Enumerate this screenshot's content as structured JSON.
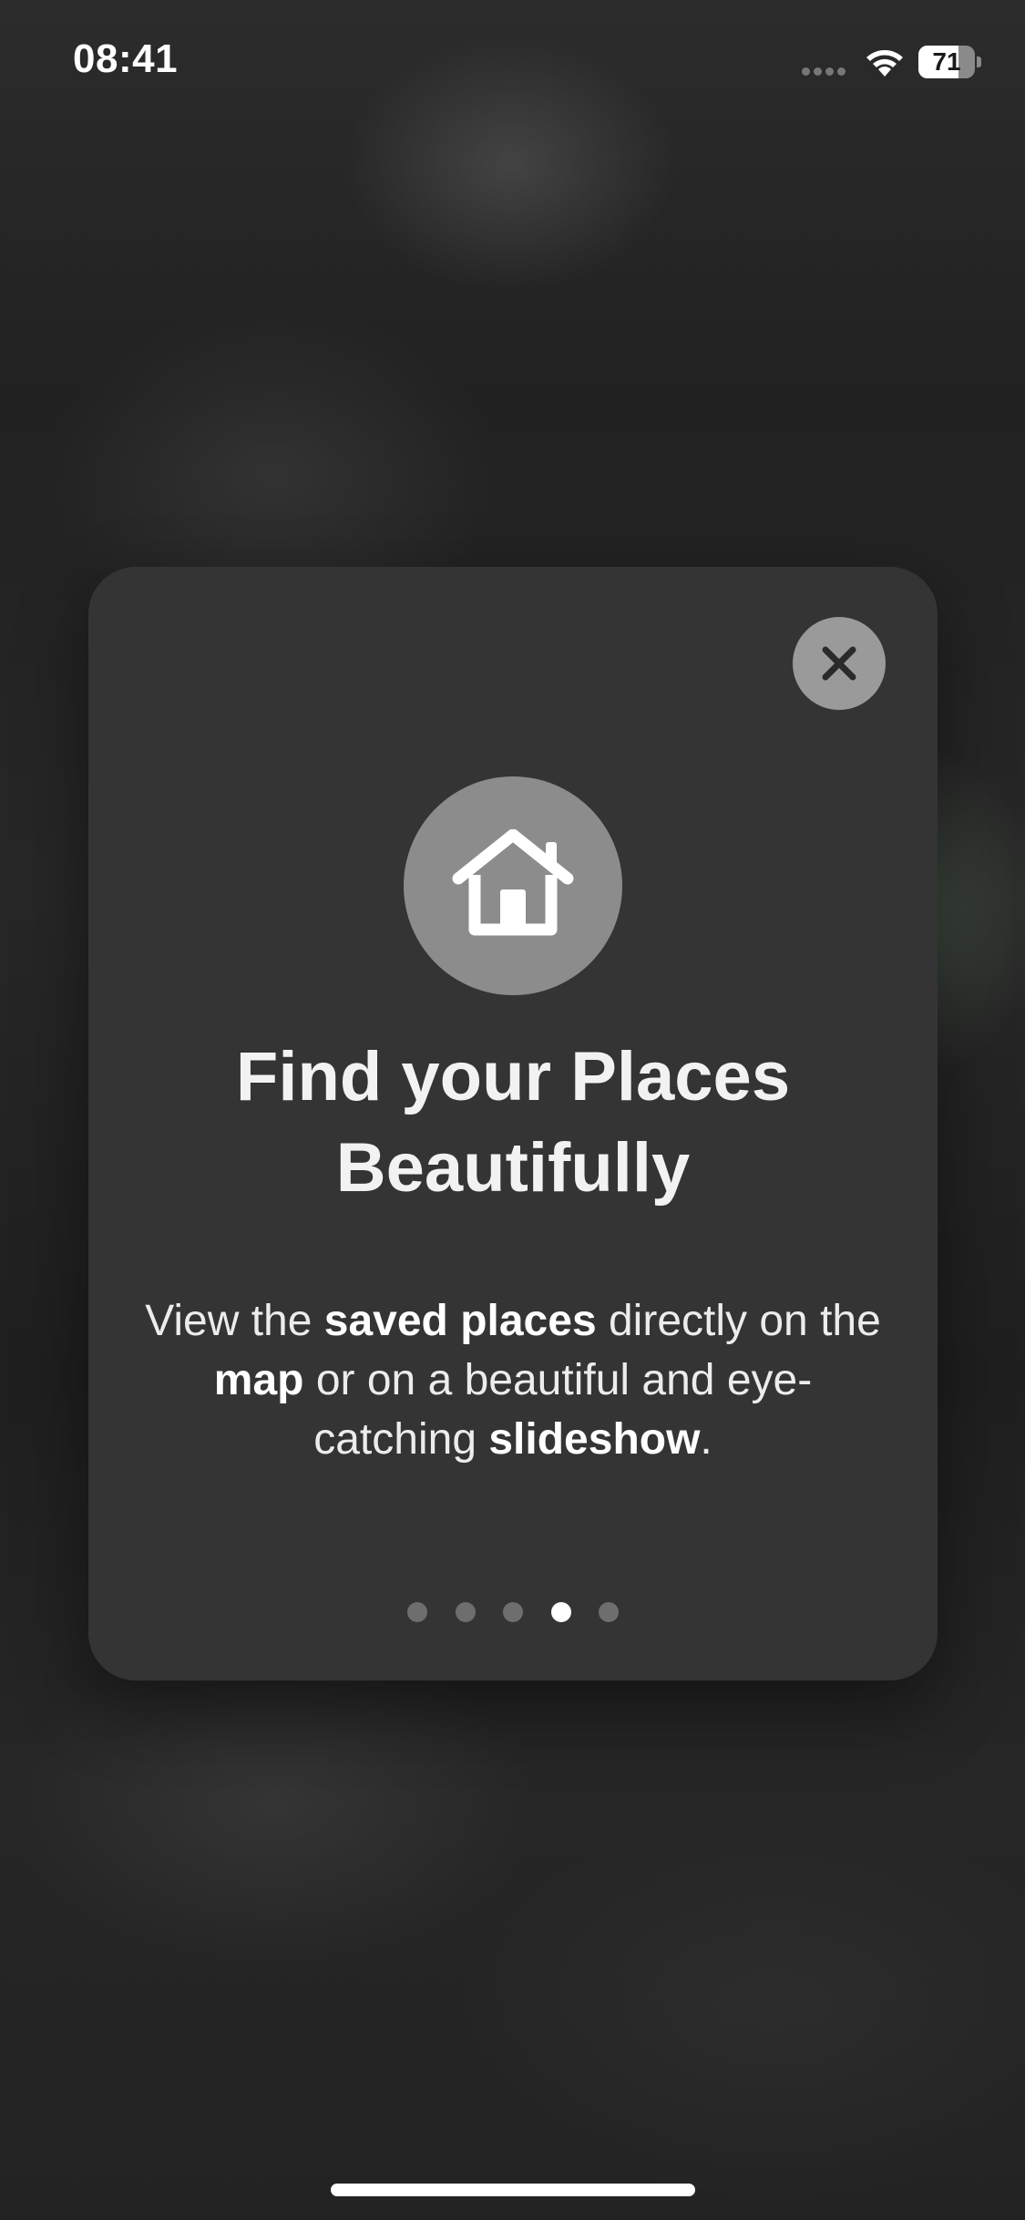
{
  "status_bar": {
    "time": "08:41",
    "battery_level": "71",
    "battery_fraction": 0.71
  },
  "card": {
    "close_icon": "close-icon",
    "feature_icon": "house-icon",
    "title_line1": "Find your Places",
    "title_line2": "Beautifully",
    "description": {
      "part1": "View the ",
      "bold1": "saved places",
      "part2": " directly on the ",
      "bold2": "map",
      "part3": " or on a beautiful and eye-catching ",
      "bold3": "slideshow",
      "part4": "."
    },
    "page_indicator": {
      "total": 5,
      "current": 4
    }
  },
  "colors": {
    "card_background": "#343434",
    "close_button": "#9a9a9a",
    "feature_icon_circle": "#8c8c8c",
    "active_dot": "#ffffff",
    "inactive_dot": "#6e6e6e"
  }
}
